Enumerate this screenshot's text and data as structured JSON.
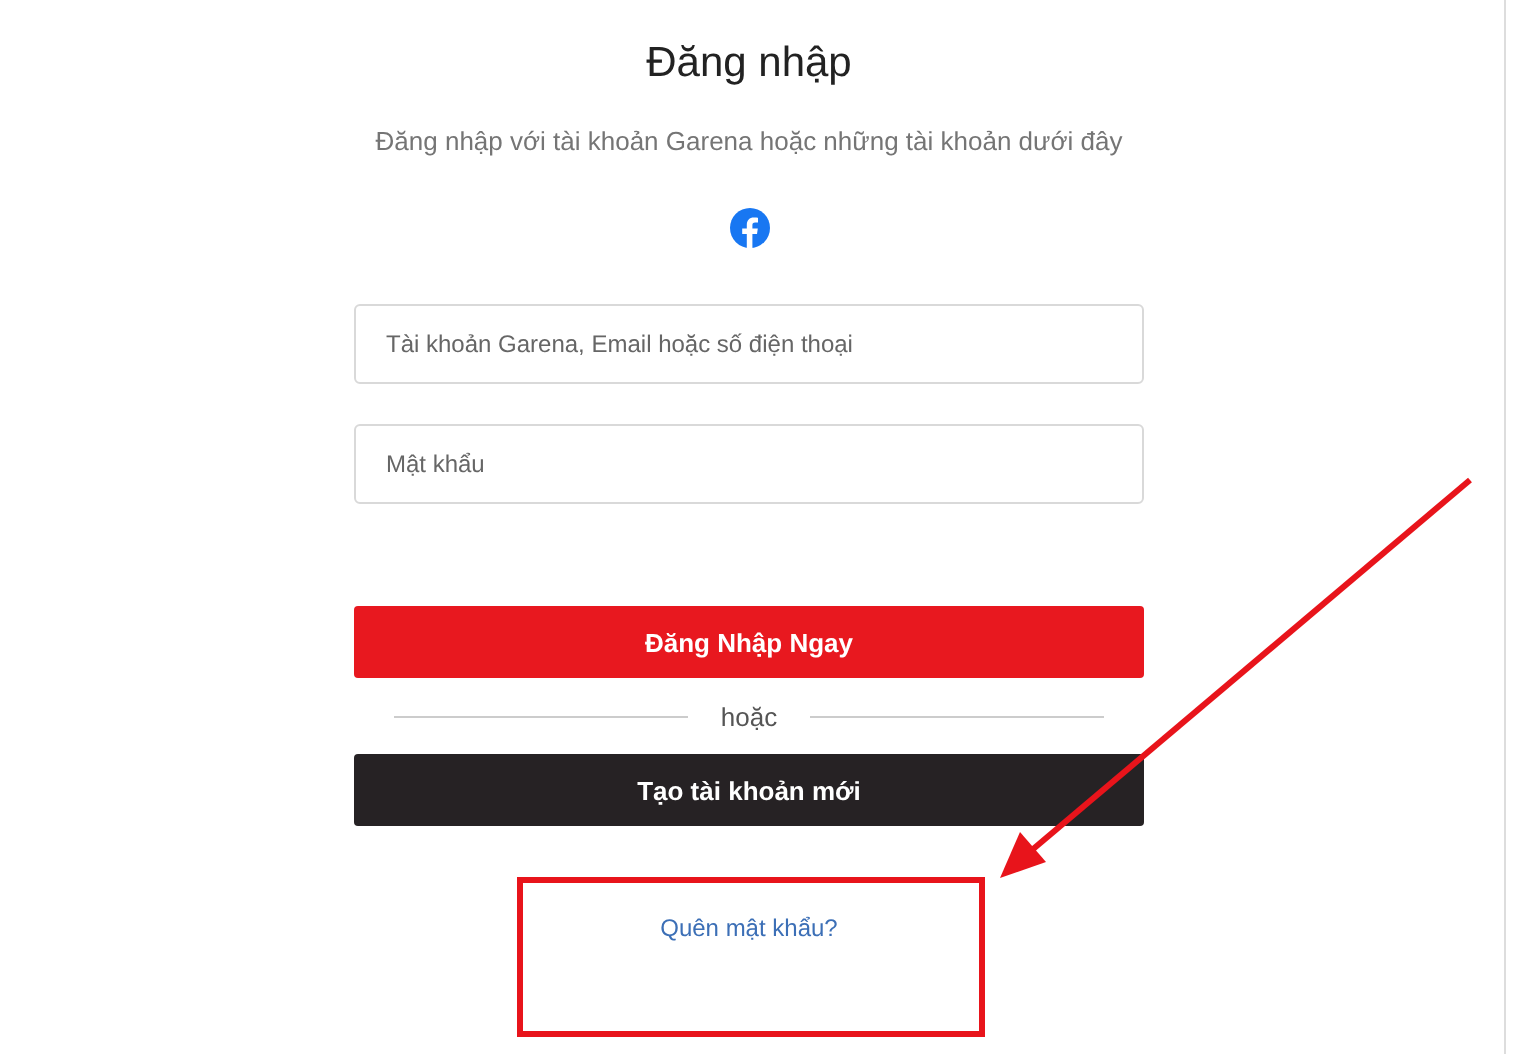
{
  "title": "Đăng nhập",
  "subtitle": "Đăng nhập với tài khoản Garena hoặc những tài khoản dưới đây",
  "fields": [
    {
      "placeholder": "Tài khoản Garena, Email hoặc số điện thoại"
    },
    {
      "placeholder": "Mật khẩu"
    }
  ],
  "login_button": "Đăng Nhập Ngay",
  "divider": "hoặc",
  "register_button": "Tạo tài khoản mới",
  "forgot_link": "Quên mật khẩu?"
}
